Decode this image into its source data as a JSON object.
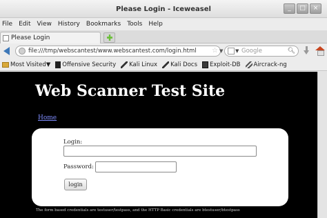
{
  "window": {
    "title": "Please Login - Iceweasel",
    "minimize": "_",
    "maximize": "□",
    "close": "×"
  },
  "menu": [
    "File",
    "Edit",
    "View",
    "History",
    "Bookmarks",
    "Tools",
    "Help"
  ],
  "tabs": [
    {
      "label": "Please Login"
    }
  ],
  "nav": {
    "url": "file:///tmp/webscantest/www.webscantest.com/login.html",
    "search_placeholder": "Google",
    "search_icon": "magnifier-icon",
    "reload_icon": "reload-icon"
  },
  "bookmarks": [
    {
      "label": "Most Visited",
      "icon": "folder-icon"
    },
    {
      "label": "Offensive Security",
      "icon": "offsec-icon"
    },
    {
      "label": "Kali Linux",
      "icon": "kali-dragon-icon"
    },
    {
      "label": "Kali Docs",
      "icon": "kali-dragon-icon"
    },
    {
      "label": "Exploit-DB",
      "icon": "exploit-db-icon"
    },
    {
      "label": "Aircrack-ng",
      "icon": "aircrack-icon"
    }
  ],
  "page": {
    "site_title": "Web Scanner Test Site",
    "home_link": "Home",
    "login_label": "Login:",
    "login_value": "",
    "password_label": "Password:",
    "password_value": "",
    "login_button": "login",
    "footnote": "The form based credentials are testuser/testpass, and the HTTP Basic credentials are btestuser/btestpass"
  },
  "colors": {
    "page_bg": "#000000",
    "form_bg": "#ffffff",
    "link": "#7f8dff"
  }
}
